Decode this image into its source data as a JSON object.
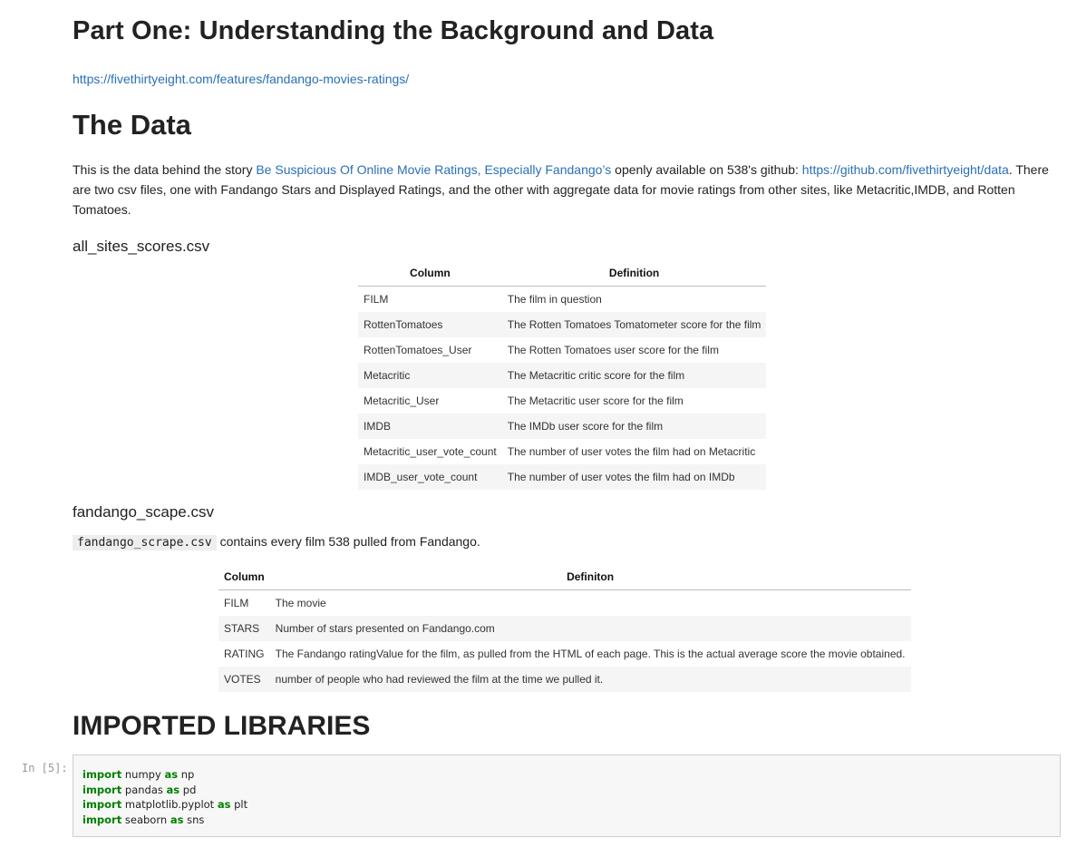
{
  "headings": {
    "part_one": "Part One: Understanding the Background and Data",
    "the_data": "The Data",
    "all_sites": "all_sites_scores.csv",
    "fandango": "fandango_scape.csv",
    "imported": "IMPORTED LIBRARIES"
  },
  "links": {
    "article_url": "https://fivethirtyeight.com/features/fandango-movies-ratings/"
  },
  "description": {
    "text_1": "This is the data behind the story ",
    "link_story": "Be Suspicious Of Online Movie Ratings, Especially Fandango’s",
    "text_2": " openly available on 538's github: ",
    "link_github": "https://github.com/fivethirtyeight/data",
    "text_3": ". There are two csv files, one with Fandango Stars and Displayed Ratings, and the other with aggregate data for movie ratings from other sites, like Metacritic,IMDB, and Rotten Tomatoes."
  },
  "all_sites_table": {
    "headers": [
      "Column",
      "Definition"
    ],
    "rows": [
      [
        "FILM",
        "The film in question"
      ],
      [
        "RottenTomatoes",
        "The Rotten Tomatoes Tomatometer score for the film"
      ],
      [
        "RottenTomatoes_User",
        "The Rotten Tomatoes user score for the film"
      ],
      [
        "Metacritic",
        "The Metacritic critic score for the film"
      ],
      [
        "Metacritic_User",
        "The Metacritic user score for the film"
      ],
      [
        "IMDB",
        "The IMDb user score for the film"
      ],
      [
        "Metacritic_user_vote_count",
        "The number of user votes the film had on Metacritic"
      ],
      [
        "IMDB_user_vote_count",
        "The number of user votes the film had on IMDb"
      ]
    ]
  },
  "fandango_intro": {
    "code": "fandango_scrape.csv",
    "text": " contains every film 538 pulled from Fandango."
  },
  "fandango_table": {
    "headers": [
      "Column",
      "Definiton"
    ],
    "rows": [
      [
        "FILM",
        "The movie"
      ],
      [
        "STARS",
        "Number of stars presented on Fandango.com"
      ],
      [
        "RATING",
        "The Fandango ratingValue for the film, as pulled from the HTML of each page. This is the actual average score the movie obtained."
      ],
      [
        "VOTES",
        "number of people who had reviewed the film at the time we pulled it."
      ]
    ]
  },
  "code_cell": {
    "prompt": "In [5]:",
    "lines": [
      {
        "kw1": "import",
        "mod": " numpy ",
        "kw2": "as",
        "alias": " np"
      },
      {
        "kw1": "import",
        "mod": " pandas ",
        "kw2": "as",
        "alias": " pd"
      },
      {
        "kw1": "import",
        "mod": " matplotlib.pyplot ",
        "kw2": "as",
        "alias": " plt"
      },
      {
        "kw1": "import",
        "mod": " seaborn ",
        "kw2": "as",
        "alias": " sns"
      }
    ]
  },
  "colors": {
    "link": "#2a6fb7",
    "keyword": "#008000",
    "row_alt": "#f5f5f5"
  }
}
